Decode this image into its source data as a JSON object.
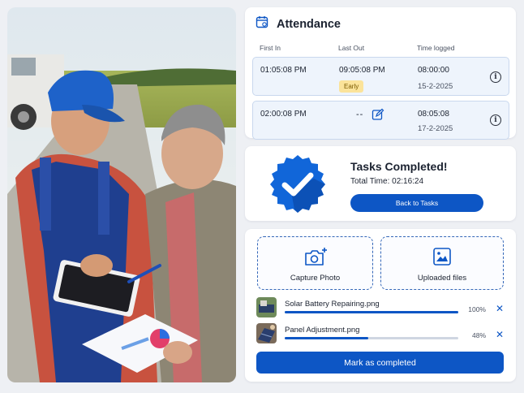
{
  "attendance": {
    "title": "Attendance",
    "columns": [
      "First In",
      "Last Out",
      "Time logged"
    ],
    "rows": [
      {
        "first_in": "01:05:08 PM",
        "last_out": "09:05:08 PM",
        "badge": "Early",
        "time_logged": "08:00:00",
        "date": "15-2-2025"
      },
      {
        "first_in": "02:00:08 PM",
        "last_out": "--",
        "time_logged": "08:05:08",
        "date": "17-2-2025"
      }
    ]
  },
  "tasks": {
    "title": "Tasks Completed!",
    "total_time": "Total Time: 02:16:24",
    "back_label": "Back to Tasks"
  },
  "upload": {
    "capture_label": "Capture Photo",
    "uploaded_label": "Uploaded files",
    "files": [
      {
        "name": "Solar Battery Repairing.png",
        "percent": "100%",
        "progress": 1.0
      },
      {
        "name": "Panel Adjustment.png",
        "percent": "48%",
        "progress": 0.48
      }
    ],
    "mark_label": "Mark as completed"
  },
  "icons": {
    "calendar": "calendar-icon",
    "edit": "edit-icon",
    "info": "info-icon",
    "camera": "camera-plus-icon",
    "image": "image-icon",
    "close": "close-icon",
    "verified": "verified-badge-icon"
  },
  "colors": {
    "primary": "#0d56c5",
    "row_bg": "#eef4fc",
    "badge": "#fbe39a"
  }
}
